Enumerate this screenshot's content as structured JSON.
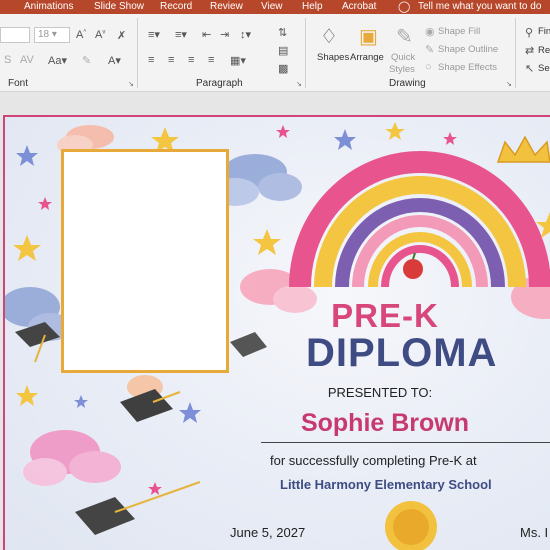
{
  "menu": {
    "tabs": [
      "Animations",
      "Slide Show",
      "Record",
      "Review",
      "View",
      "Help",
      "Acrobat"
    ],
    "tell_me": "Tell me what you want to do"
  },
  "ribbon": {
    "font_size": "18",
    "groups": {
      "font": "Font",
      "paragraph": "Paragraph",
      "drawing": "Drawing"
    },
    "drawing": {
      "shapes": "Shapes",
      "arrange": "Arrange",
      "quick_styles_1": "Quick",
      "quick_styles_2": "Styles",
      "shape_fill": "Shape Fill",
      "shape_outline": "Shape Outline",
      "shape_effects": "Shape Effects"
    },
    "editing": {
      "find": "Fin",
      "replace": "Re",
      "select": "Se"
    }
  },
  "slide": {
    "title_line1": "PRE-K",
    "title_line2": "DIPLOMA",
    "presented_to": "PRESENTED TO:",
    "student_name": "Sophie Brown",
    "completion_text": "for successfully completing Pre-K at",
    "school_name": "Little Harmony Elementary School",
    "date": "June 5, 2027",
    "teacher_partial": "Ms. I"
  },
  "colors": {
    "menu_bar": "#b7472a",
    "border_pink": "#d1447a",
    "title_pink": "#d8477a",
    "title_navy": "#3e4c83",
    "photo_frame": "#e6a93a"
  }
}
